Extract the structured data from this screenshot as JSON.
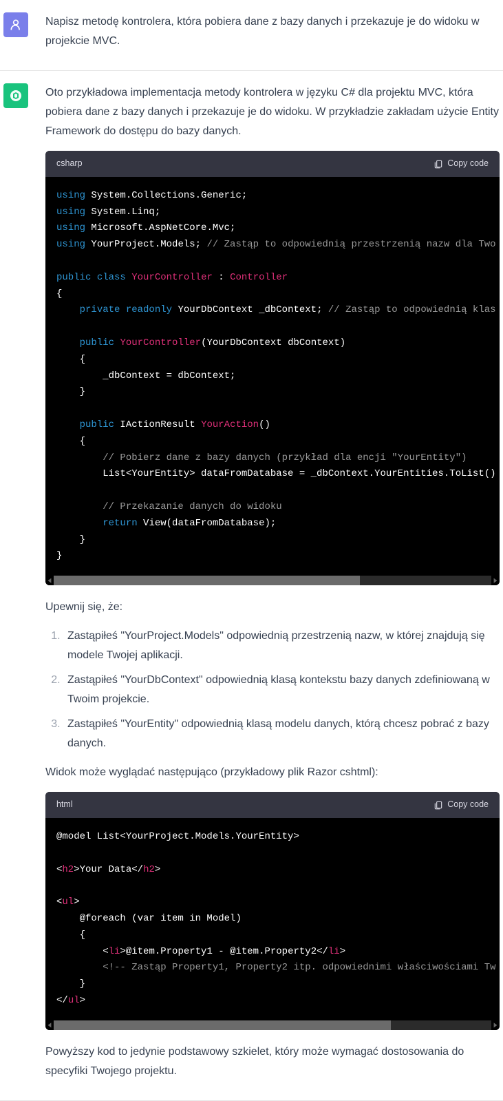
{
  "user_message": {
    "text": "Napisz metodę kontrolera, która pobiera dane z bazy danych i przekazuje je do widoku w projekcie MVC."
  },
  "assistant": {
    "intro": "Oto przykładowa implementacja metody kontrolera w języku C# dla projektu MVC, która pobiera dane z bazy danych i przekazuje je do widoku. W przykładzie zakładam użycie Entity Framework do dostępu do bazy danych.",
    "code1_lang": "csharp",
    "copy_label": "Copy code",
    "c": {
      "l01a": "using",
      "l01b": " System.Collections.Generic;",
      "l02a": "using",
      "l02b": " System.Linq;",
      "l03a": "using",
      "l03b": " Microsoft.AspNetCore.Mvc;",
      "l04a": "using",
      "l04b": " YourProject.Models; ",
      "l04c": "// Zastąp to odpowiednią przestrzenią nazw dla Two",
      "l05": "",
      "l06a": "public",
      "l06b": " ",
      "l06c": "class",
      "l06d": " ",
      "l06e": "YourController",
      "l06f": " : ",
      "l06g": "Controller",
      "l07": "{",
      "l08a": "    ",
      "l08b": "private",
      "l08c": " ",
      "l08d": "readonly",
      "l08e": " YourDbContext _dbContext; ",
      "l08f": "// Zastąp to odpowiednią klas",
      "l09": "",
      "l10a": "    ",
      "l10b": "public",
      "l10c": " ",
      "l10d": "YourController",
      "l10e": "(YourDbContext dbContext)",
      "l11": "    {",
      "l12": "        _dbContext = dbContext;",
      "l13": "    }",
      "l14": "",
      "l15a": "    ",
      "l15b": "public",
      "l15c": " IActionResult ",
      "l15d": "YourAction",
      "l15e": "()",
      "l16": "    {",
      "l17a": "        ",
      "l17b": "// Pobierz dane z bazy danych (przykład dla encji \"YourEntity\")",
      "l18": "        List<YourEntity> dataFromDatabase = _dbContext.YourEntities.ToList()",
      "l19": "",
      "l20a": "        ",
      "l20b": "// Przekazanie danych do widoku",
      "l21a": "        ",
      "l21b": "return",
      "l21c": " View(dataFromDatabase);",
      "l22": "    }",
      "l23": "}"
    },
    "ensure_text": "Upewnij się, że:",
    "list": {
      "i1": "Zastąpiłeś \"YourProject.Models\" odpowiednią przestrzenią nazw, w której znajdują się modele Twojej aplikacji.",
      "i2": "Zastąpiłeś \"YourDbContext\" odpowiednią klasą kontekstu bazy danych zdefiniowaną w Twoim projekcie.",
      "i3": "Zastąpiłeś \"YourEntity\" odpowiednią klasą modelu danych, którą chcesz pobrać z bazy danych."
    },
    "view_text": "Widok może wyglądać następująco (przykładowy plik Razor cshtml):",
    "code2_lang": "html",
    "h": {
      "l01": "@model List<YourProject.Models.YourEntity>",
      "l02": "",
      "l03a": "<",
      "l03b": "h2",
      "l03c": ">",
      "l03d": "Your Data",
      "l03e": "</",
      "l03f": "h2",
      "l03g": ">",
      "l04": "",
      "l05a": "<",
      "l05b": "ul",
      "l05c": ">",
      "l06": "    @foreach (var item in Model)",
      "l07": "    {",
      "l08a": "        ",
      "l08b": "<",
      "l08c": "li",
      "l08d": ">",
      "l08e": "@item.Property1 - @item.Property2",
      "l08f": "</",
      "l08g": "li",
      "l08h": ">",
      "l09a": "        ",
      "l09b": "<!-- Zastąp Property1, Property2 itp. odpowiednimi właściwościami Tw",
      "l10": "    }",
      "l11a": "</",
      "l11b": "ul",
      "l11c": ">"
    },
    "outro": "Powyższy kod to jedynie podstawowy szkielet, który może wymagać dostosowania do specyfiki Twojego projektu."
  }
}
